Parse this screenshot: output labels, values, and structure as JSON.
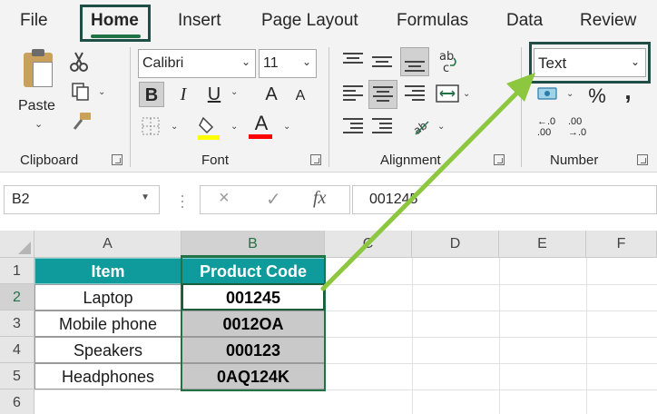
{
  "menu": {
    "tabs": [
      "File",
      "Home",
      "Insert",
      "Page Layout",
      "Formulas",
      "Data",
      "Review"
    ],
    "active_tab": "Home"
  },
  "ribbon": {
    "clipboard": {
      "paste_label": "Paste",
      "group_label": "Clipboard"
    },
    "font": {
      "font_name": "Calibri",
      "font_size": "11",
      "bold": "B",
      "italic": "I",
      "underline": "U",
      "grow": "A",
      "shrink": "A",
      "font_color_letter": "A",
      "group_label": "Font",
      "highlight_color": "#ffff00",
      "font_color": "#ff0000"
    },
    "alignment": {
      "group_label": "Alignment"
    },
    "number": {
      "format_value": "Text",
      "percent": "%",
      "comma": ",",
      "group_label": "Number",
      "inc_decimal_top": "←.0",
      "inc_decimal_bottom": ".00",
      "dec_decimal_top": ".00",
      "dec_decimal_bottom": "→.0"
    }
  },
  "formula_bar": {
    "name_box": "B2",
    "cancel": "×",
    "enter": "✓",
    "fx": "fx",
    "value": "001245"
  },
  "sheet": {
    "columns": [
      "A",
      "B",
      "C",
      "D",
      "E",
      "F"
    ],
    "rows": [
      "1",
      "2",
      "3",
      "4",
      "5",
      "6"
    ],
    "header": {
      "item": "Item",
      "code": "Product Code"
    },
    "data": [
      {
        "item": "Laptop",
        "code": "001245"
      },
      {
        "item": "Mobile phone",
        "code": "0012OA"
      },
      {
        "item": "Speakers",
        "code": "000123"
      },
      {
        "item": "Headphones",
        "code": "0AQ124K"
      }
    ],
    "colors": {
      "header_fill": "#0f9b9b",
      "selection": "#217346",
      "code_fill": "#c9c9c9",
      "annotation_arrow": "#8dc63f",
      "highlight_box": "#1f4e46"
    }
  }
}
